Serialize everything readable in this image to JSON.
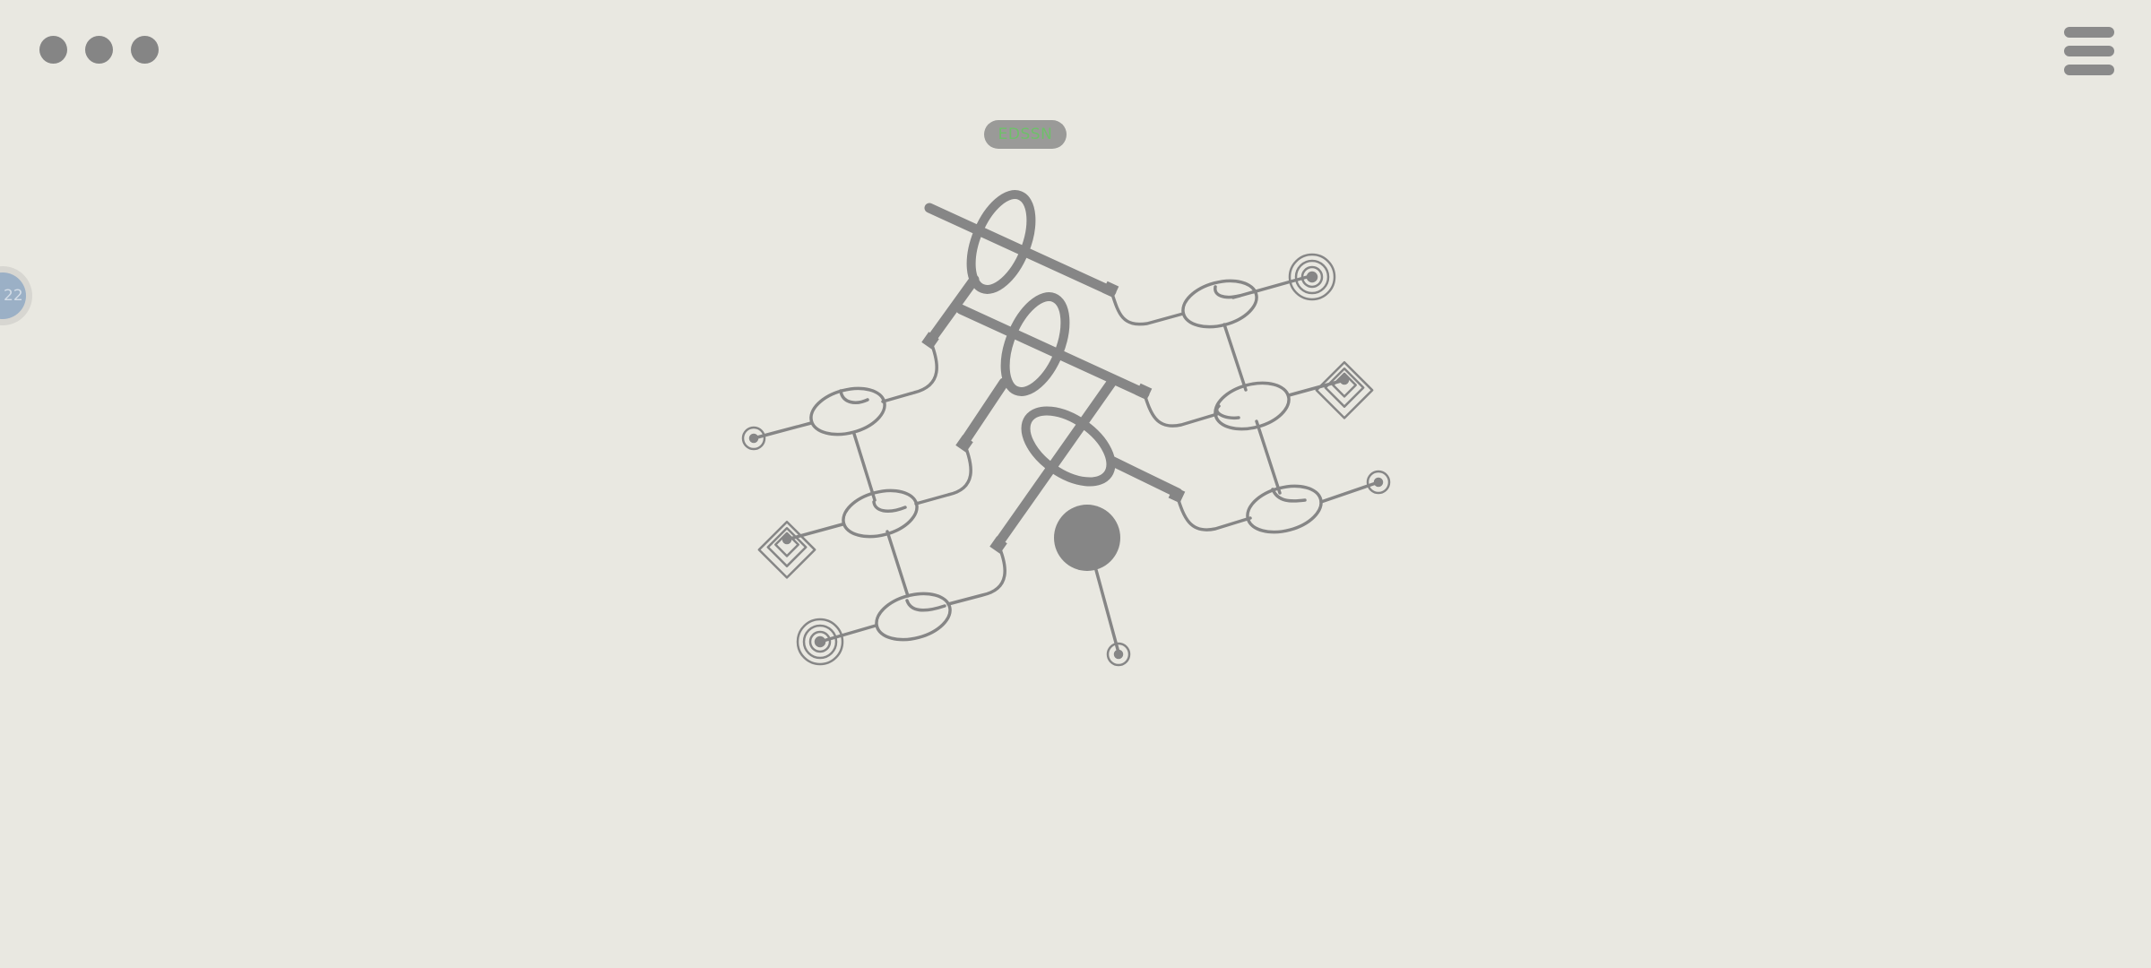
{
  "window_controls": {
    "icons": [
      "dot-icon",
      "dot-icon",
      "dot-icon"
    ]
  },
  "menu": {
    "icon": "hamburger-menu-icon"
  },
  "puzzle_code": {
    "text": "EDSSN"
  },
  "level": {
    "label": "22"
  },
  "colors": {
    "background": "#e9e8e1",
    "ink": "#858585",
    "code_text": "#6fc06a",
    "level_fill": "#9bb0c6"
  },
  "board": {
    "node_types": [
      "concentric-circle-target-icon",
      "concentric-diamond-target-icon",
      "small-circle-endpoint-icon",
      "ring-link-icon",
      "filled-circle-icon",
      "bar-handle-icon"
    ]
  }
}
